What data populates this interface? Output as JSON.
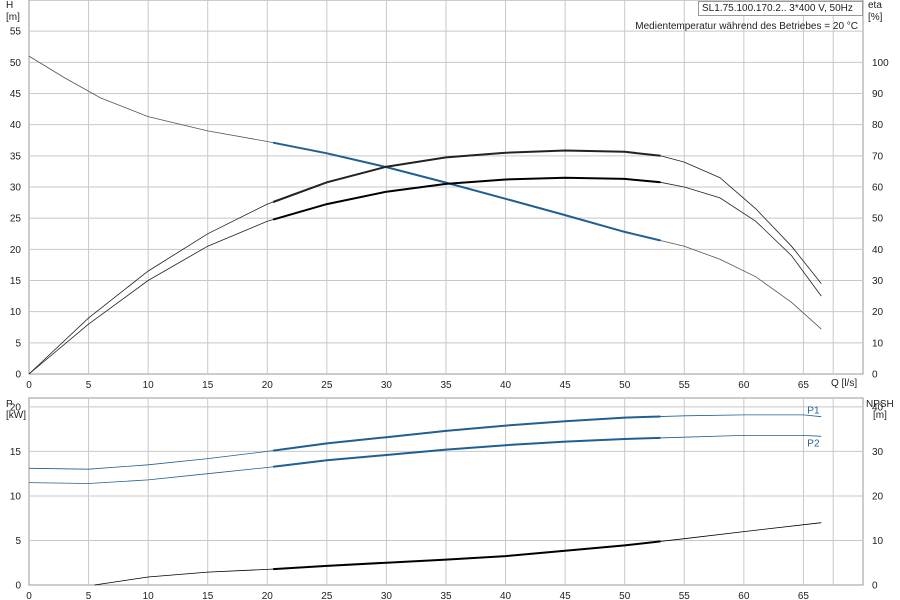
{
  "chart_data": [
    {
      "type": "line",
      "title": "SL1.75.100.170.2.. 3*400 V, 50Hz",
      "subtitle": "Medientemperatur während des Betriebes = 20 °C",
      "x_axis": {
        "label": "Q [l/s]",
        "range": [
          0,
          70
        ],
        "ticks": [
          0,
          5,
          10,
          15,
          20,
          25,
          30,
          35,
          40,
          45,
          50,
          55,
          60,
          65
        ]
      },
      "y_left": {
        "label": "H",
        "unit": "[m]",
        "range": [
          0,
          60
        ],
        "ticks": [
          0,
          5,
          10,
          15,
          20,
          25,
          30,
          35,
          40,
          45,
          50,
          55
        ]
      },
      "y_right": {
        "label": "eta",
        "unit": "[%]",
        "range": [
          0,
          120
        ],
        "ticks": [
          0,
          10,
          20,
          30,
          40,
          50,
          60,
          70,
          80,
          90,
          100
        ]
      },
      "grid": true,
      "series": [
        {
          "axis": "left",
          "color": "#555555",
          "width": 0.8,
          "x": [
            0,
            3,
            6,
            10,
            15,
            20,
            25,
            30,
            35,
            40,
            45,
            50,
            55,
            58,
            61,
            64,
            66.5
          ],
          "y": [
            51,
            47.5,
            44.3,
            41.3,
            39,
            37.3,
            35.4,
            33.2,
            30.7,
            28.1,
            25.5,
            22.8,
            20.5,
            18.4,
            15.6,
            11.5,
            7.2
          ],
          "operating_range": [
            20.5,
            53
          ],
          "operating_color": "#1f5f93"
        },
        {
          "axis": "right",
          "color": "#222222",
          "width": 0.8,
          "x": [
            0,
            5,
            10,
            15,
            20,
            25,
            30,
            35,
            40,
            45,
            50,
            53,
            55,
            58,
            61,
            64,
            66.5
          ],
          "y": [
            0,
            18,
            33,
            45,
            54.5,
            61.5,
            66.5,
            69.5,
            71,
            71.7,
            71.3,
            70,
            68,
            63,
            53,
            41,
            29
          ],
          "operating_range": [
            20.5,
            53
          ],
          "operating_color": "#222222"
        },
        {
          "axis": "right",
          "color": "#222222",
          "width": 0.8,
          "x": [
            0,
            5,
            10,
            15,
            20,
            25,
            30,
            35,
            40,
            45,
            50,
            53,
            55,
            58,
            61,
            64,
            66.5
          ],
          "y": [
            0,
            16,
            30,
            41,
            49,
            54.5,
            58.5,
            61,
            62.4,
            63,
            62.6,
            61.5,
            60,
            56.5,
            49,
            38,
            25
          ],
          "operating_range": [
            20.5,
            53
          ],
          "operating_color": "#000000"
        }
      ]
    },
    {
      "type": "line",
      "x_axis": {
        "range": [
          0,
          70
        ],
        "ticks": [
          0,
          5,
          10,
          15,
          20,
          25,
          30,
          35,
          40,
          45,
          50,
          55,
          60,
          65
        ]
      },
      "y_left": {
        "label": "P",
        "unit": "[kW]",
        "range": [
          0,
          21
        ],
        "ticks": [
          0,
          5,
          10,
          15,
          20
        ]
      },
      "y_right": {
        "label": "NPSH",
        "unit": "[m]",
        "range": [
          0,
          42
        ],
        "ticks": [
          0,
          10,
          20,
          30,
          40
        ]
      },
      "grid": true,
      "series": [
        {
          "name": "P1",
          "axis": "left",
          "color": "#1f5f93",
          "width": 0.8,
          "x": [
            0,
            5,
            10,
            15,
            20,
            25,
            30,
            35,
            40,
            45,
            50,
            55,
            60,
            65,
            66.5
          ],
          "y": [
            13.1,
            13,
            13.5,
            14.2,
            15,
            15.9,
            16.6,
            17.3,
            17.9,
            18.4,
            18.8,
            19,
            19.1,
            19.1,
            18.9
          ],
          "operating_range": [
            20.5,
            53
          ],
          "operating_color": "#1f5f93"
        },
        {
          "name": "P2",
          "axis": "left",
          "color": "#1f5f93",
          "width": 0.8,
          "x": [
            0,
            5,
            10,
            15,
            20,
            25,
            30,
            35,
            40,
            45,
            50,
            55,
            60,
            65,
            66.5
          ],
          "y": [
            11.5,
            11.4,
            11.8,
            12.5,
            13.2,
            14,
            14.6,
            15.2,
            15.7,
            16.1,
            16.4,
            16.6,
            16.8,
            16.8,
            16.7
          ],
          "operating_range": [
            20.5,
            53
          ],
          "operating_color": "#1f5f93"
        },
        {
          "axis": "right",
          "color": "#000000",
          "width": 0.8,
          "x": [
            5.5,
            10,
            15,
            20,
            25,
            30,
            35,
            40,
            45,
            50,
            55,
            60,
            66.5
          ],
          "y": [
            0,
            1.8,
            2.9,
            3.5,
            4.3,
            5,
            5.7,
            6.5,
            7.7,
            8.9,
            10.4,
            12,
            14
          ],
          "operating_range": [
            20.5,
            53
          ],
          "operating_color": "#000000"
        }
      ]
    }
  ]
}
